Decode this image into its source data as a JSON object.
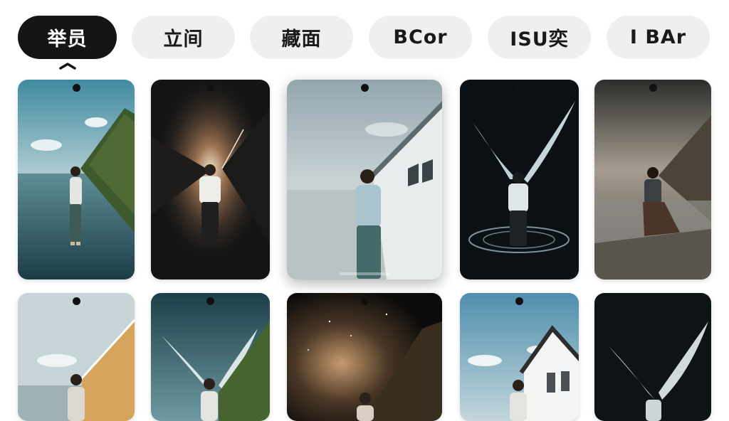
{
  "tabs": [
    {
      "label": "举员",
      "active": true
    },
    {
      "label": "立间",
      "active": false
    },
    {
      "label": "藏面",
      "active": false
    },
    {
      "label": "BCor",
      "active": false
    },
    {
      "label": "ISU奕",
      "active": false
    },
    {
      "label": "I BAr",
      "active": false
    }
  ],
  "gallery": {
    "items": [
      {
        "theme": "lake-cliff"
      },
      {
        "theme": "cosmic-rift"
      },
      {
        "theme": "misty-white-building"
      },
      {
        "theme": "feather-wings-dark"
      },
      {
        "theme": "foggy-coast"
      },
      {
        "theme": "orange-house-sea"
      },
      {
        "theme": "wings-green-cliff"
      },
      {
        "theme": "starry-mountain"
      },
      {
        "theme": "white-house-sky"
      },
      {
        "theme": "feather-dark"
      }
    ]
  },
  "colors": {
    "tab_active_bg": "#151515",
    "tab_inactive_bg": "#efefef"
  }
}
